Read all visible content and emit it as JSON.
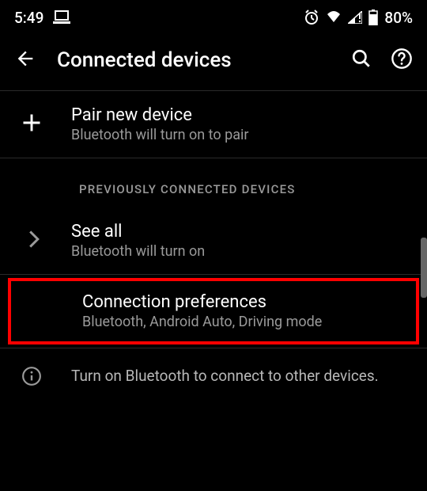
{
  "status_bar": {
    "time": "5:49",
    "battery_percent": "80%"
  },
  "header": {
    "title": "Connected devices"
  },
  "pair": {
    "title": "Pair new device",
    "subtitle": "Bluetooth will turn on to pair"
  },
  "section": {
    "label": "PREVIOUSLY CONNECTED DEVICES"
  },
  "see_all": {
    "title": "See all",
    "subtitle": "Bluetooth will turn on"
  },
  "connection_prefs": {
    "title": "Connection preferences",
    "subtitle": "Bluetooth, Android Auto, Driving mode"
  },
  "info": {
    "text": "Turn on Bluetooth to connect to other devices."
  }
}
